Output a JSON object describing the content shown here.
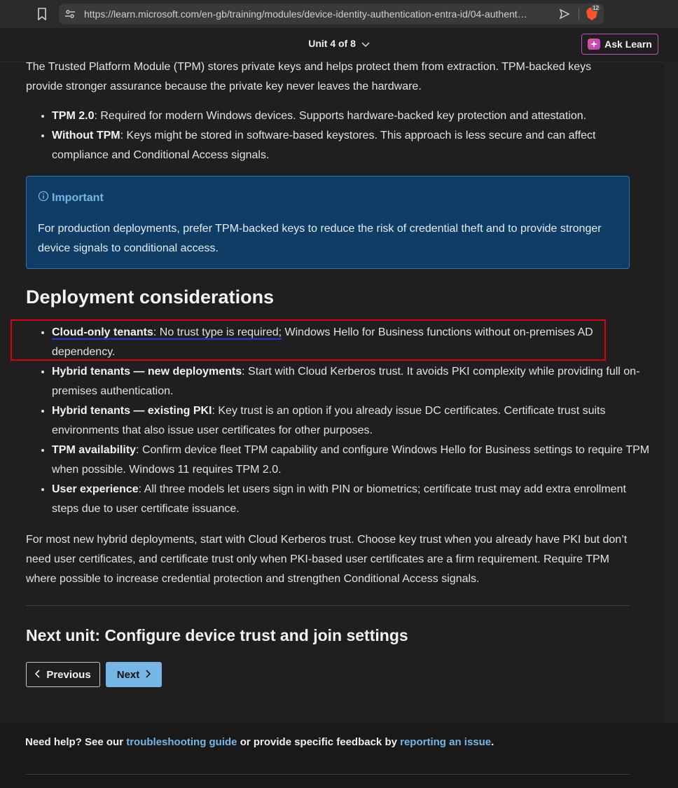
{
  "browser": {
    "url": "https://learn.microsoft.com/en-gb/training/modules/device-identity-authentication-entra-id/04-authent…",
    "brave_badge": "12"
  },
  "header": {
    "unit_label": "Unit 4 of 8",
    "ask_learn_label": "Ask Learn"
  },
  "intro": {
    "text": "The Trusted Platform Module (TPM) stores private keys and helps protect them from extraction. TPM-backed keys provide stronger assurance because the private key never leaves the hardware.",
    "items": [
      {
        "term": "TPM 2.0",
        "text": ": Required for modern Windows devices. Supports hardware-backed key protection and attestation."
      },
      {
        "term": "Without TPM",
        "text": ": Keys might be stored in software-based keystores. This approach is less secure and can affect compliance and Conditional Access signals."
      }
    ]
  },
  "important": {
    "title": "Important",
    "text": "For production deployments, prefer TPM-backed keys to reduce the risk of credential theft and to provide stronger device signals to conditional access."
  },
  "deployment": {
    "heading": "Deployment considerations",
    "first": {
      "term": "Cloud-only tenants",
      "underlined_rest": ": No trust type is required;",
      "rest": " Windows Hello for Business functions without on-premises AD dependency."
    },
    "items": [
      {
        "term": "Hybrid tenants — new deployments",
        "text": ": Start with Cloud Kerberos trust. It avoids PKI complexity while providing full on-premises authentication."
      },
      {
        "term": "Hybrid tenants — existing PKI",
        "text": ": Key trust is an option if you already issue DC certificates. Certificate trust suits environments that also issue user certificates for other purposes."
      },
      {
        "term": "TPM availability",
        "text": ": Confirm device fleet TPM capability and configure Windows Hello for Business settings to require TPM when possible. Windows 11 requires TPM 2.0."
      },
      {
        "term": "User experience",
        "text": ": All three models let users sign in with PIN or biometrics; certificate trust may add extra enrollment steps due to user certificate issuance."
      }
    ],
    "summary": "For most new hybrid deployments, start with Cloud Kerberos trust. Choose key trust when you already have PKI but don’t need user certificates, and certificate trust only when PKI-based user certificates are a firm requirement. Require TPM where possible to increase credential protection and strengthen Conditional Access signals."
  },
  "next_unit": {
    "heading": "Next unit: Configure device trust and join settings",
    "previous_label": "Previous",
    "next_label": "Next"
  },
  "footer": {
    "prefix": "Need help? See our ",
    "link1": "troubleshooting guide",
    "middle": " or provide specific feedback by ",
    "link2": "reporting an issue",
    "suffix": "."
  },
  "colors": {
    "accent": "#75b6e7",
    "important_bg": "#0f3d66",
    "highlight_red": "#e0000e",
    "ask_learn_border": "#c04fbf"
  }
}
